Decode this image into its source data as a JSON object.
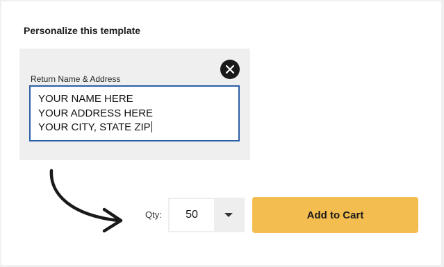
{
  "personalize": {
    "heading": "Personalize this template",
    "field_label": "Return Name & Address",
    "address_lines": [
      "YOUR NAME HERE",
      "YOUR ADDRESS HERE",
      "YOUR CITY, STATE ZIP"
    ],
    "close_icon": "close-icon"
  },
  "purchase": {
    "qty_label": "Qty:",
    "qty_value": "50",
    "add_to_cart_label": "Add to Cart"
  },
  "colors": {
    "accent_button": "#f4bd4f",
    "input_border": "#2b5ea7",
    "panel_bg": "#efefef"
  }
}
